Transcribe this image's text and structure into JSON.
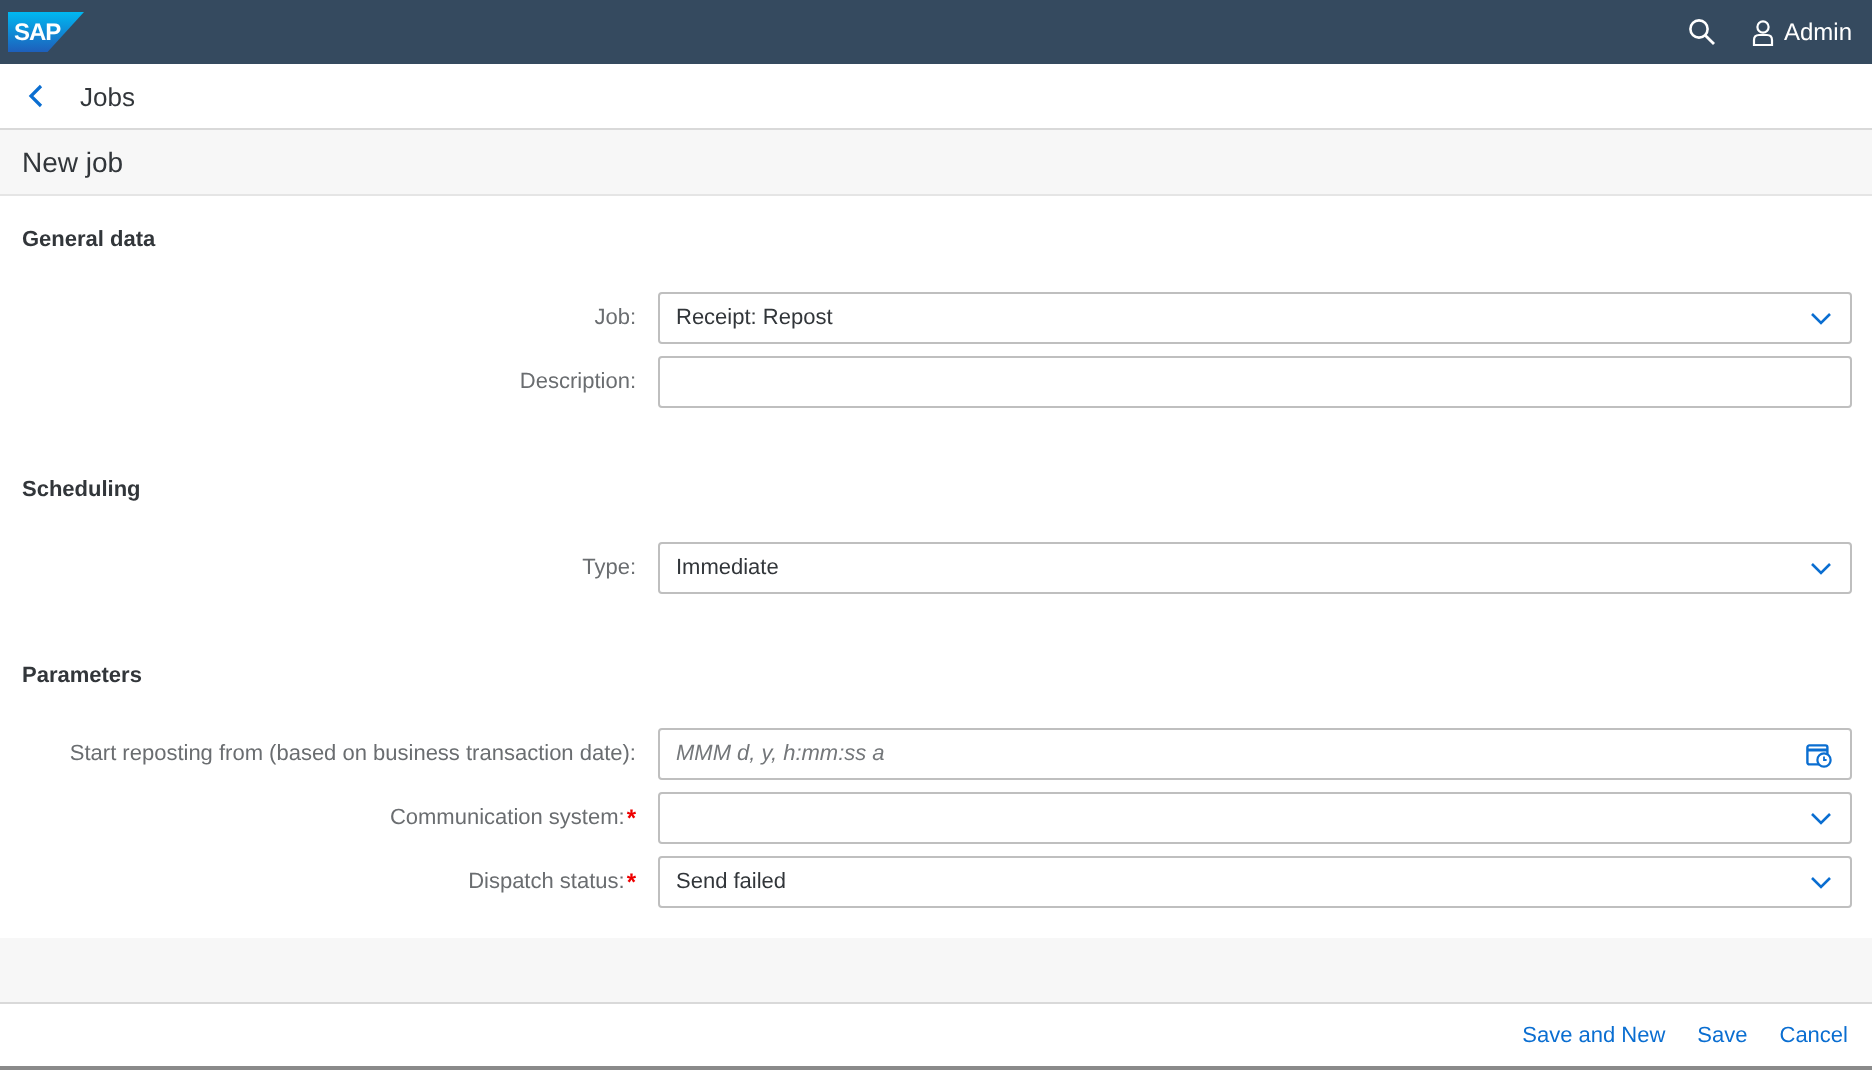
{
  "shell": {
    "logo": "SAP",
    "user": "Admin"
  },
  "nav": {
    "title": "Jobs"
  },
  "page_title": "New job",
  "sections": [
    {
      "title": "General data",
      "fields": [
        {
          "label": "Job:",
          "kind": "select",
          "value": "Receipt: Repost",
          "required": false
        },
        {
          "label": "Description:",
          "kind": "text",
          "required": false
        }
      ]
    },
    {
      "title": "Scheduling",
      "fields": [
        {
          "label": "Type:",
          "kind": "select",
          "value": "Immediate",
          "required": false
        }
      ]
    },
    {
      "title": "Parameters",
      "fields": [
        {
          "label": "Start reposting from (based on business transaction date):",
          "kind": "date",
          "placeholder": "MMM d, y, h:mm:ss a",
          "required": false
        },
        {
          "label": "Communication system:",
          "kind": "select",
          "required": true
        },
        {
          "label": "Dispatch status:",
          "kind": "select",
          "value": "Send failed",
          "required": true
        }
      ]
    }
  ],
  "required_mark": "*",
  "footer_buttons": [
    "Save and New",
    "Save",
    "Cancel"
  ]
}
